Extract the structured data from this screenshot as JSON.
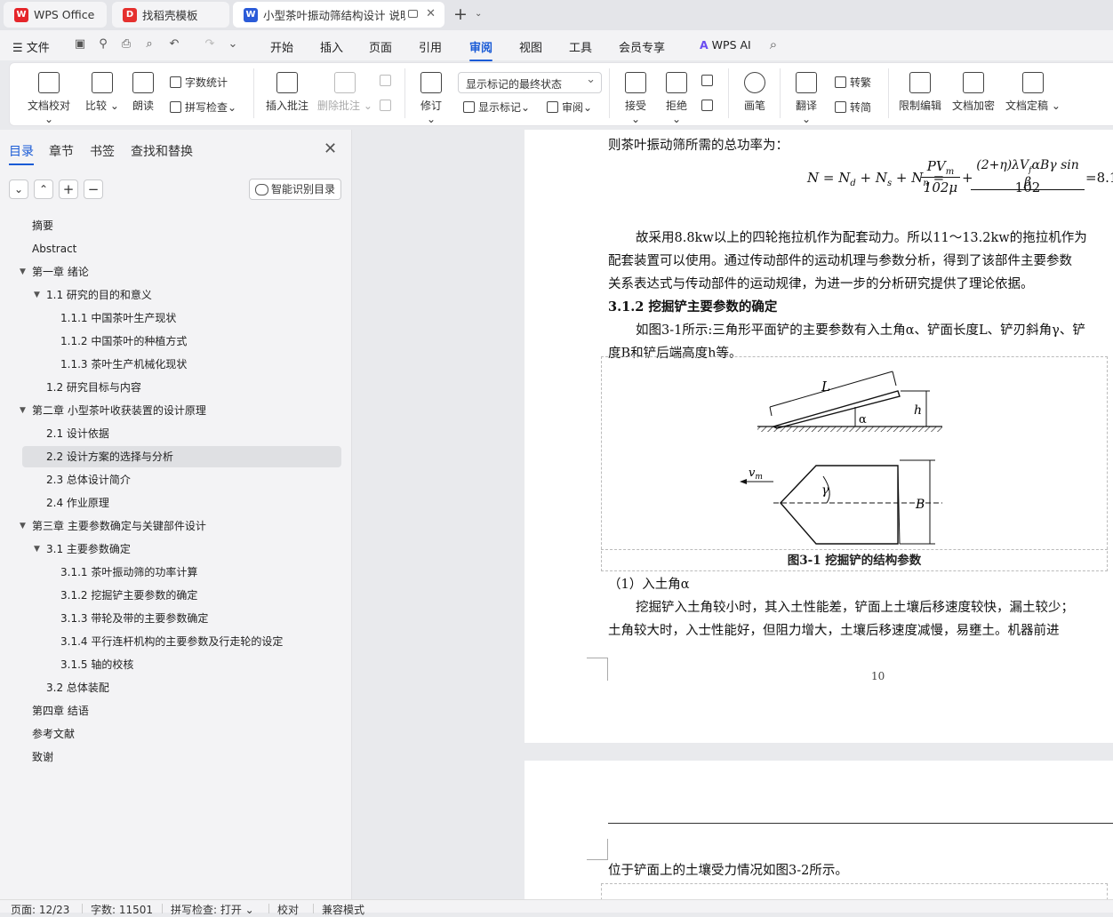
{
  "tabs": [
    {
      "label": "WPS Office",
      "logo_color": "#e5252a",
      "logo": "W"
    },
    {
      "label": "找稻壳模板",
      "logo_color": "#e5302e",
      "logo": "D"
    },
    {
      "label": "小型茶叶振动筛结构设计 说明",
      "logo_color": "#2b5bd8",
      "logo": "W"
    }
  ],
  "menu": {
    "file": "文件",
    "items": [
      "开始",
      "插入",
      "页面",
      "引用",
      "审阅",
      "视图",
      "工具",
      "会员专享"
    ],
    "active": "审阅",
    "wps_ai": "WPS AI"
  },
  "ribbon": {
    "doc_check": "文档校对",
    "compare": "比较",
    "read": "朗读",
    "word_count": "字数统计",
    "spell_check": "拼写检查",
    "insert_comment": "插入批注",
    "delete_comment": "删除批注",
    "revise": "修订",
    "markup_combo": "显示标记的最终状态",
    "show_markup": "显示标记",
    "review": "审阅",
    "accept": "接受",
    "reject": "拒绝",
    "pen": "画笔",
    "translate": "翻译",
    "to_trad": "转繁",
    "to_simp": "转简",
    "restrict_edit": "限制编辑",
    "encrypt": "文档加密",
    "finalize": "文档定稿"
  },
  "pane": {
    "tabs": [
      "目录",
      "章节",
      "书签",
      "查找和替换"
    ],
    "smart_button": "智能识别目录",
    "toc": [
      {
        "t": "摘要",
        "lvl": 0
      },
      {
        "t": "Abstract",
        "lvl": 0
      },
      {
        "t": "第一章  绪论",
        "lvl": 0,
        "exp": true
      },
      {
        "t": "1.1   研究的目的和意义",
        "lvl": 1,
        "exp": true
      },
      {
        "t": "1.1.1   中国茶叶生产现状",
        "lvl": 2
      },
      {
        "t": "1.1.2   中国茶叶的种植方式",
        "lvl": 2
      },
      {
        "t": "1.1.3   茶叶生产机械化现状",
        "lvl": 2
      },
      {
        "t": "1.2   研究目标与内容",
        "lvl": 1
      },
      {
        "t": "第二章  小型茶叶收获装置的设计原理",
        "lvl": 0,
        "exp": true
      },
      {
        "t": "2.1   设计依据",
        "lvl": 1
      },
      {
        "t": "2.2   设计方案的选择与分析",
        "lvl": 1,
        "sel": true
      },
      {
        "t": "2.3   总体设计简介",
        "lvl": 1
      },
      {
        "t": "2.4   作业原理",
        "lvl": 1
      },
      {
        "t": "第三章  主要参数确定与关键部件设计",
        "lvl": 0,
        "exp": true
      },
      {
        "t": "3.1  主要参数确定",
        "lvl": 1,
        "exp": true
      },
      {
        "t": "3.1.1  茶叶振动筛的功率计算",
        "lvl": 2
      },
      {
        "t": "3.1.2  挖掘铲主要参数的确定",
        "lvl": 2
      },
      {
        "t": "3.1.3  带轮及带的主要参数确定",
        "lvl": 2
      },
      {
        "t": "3.1.4 平行连杆机构的主要参数及行走轮的设定",
        "lvl": 2
      },
      {
        "t": "3.1.5  轴的校核",
        "lvl": 2
      },
      {
        "t": "3.2  总体装配",
        "lvl": 1
      },
      {
        "t": "第四章    结语",
        "lvl": 0
      },
      {
        "t": "参考文献",
        "lvl": 0
      },
      {
        "t": "致谢",
        "lvl": 0
      }
    ]
  },
  "doc": {
    "l1": "则茶叶振动筛所需的总功率为：",
    "formula": {
      "lhs": "N = N",
      "d": "d",
      "s": "s",
      "n": "n",
      "num1": "PV",
      "m": "m",
      "den1": "102μ",
      "num2": "(2+η)λV",
      "f": "f",
      "num2b": "αBγ sin β",
      "den2": "102",
      "res": "=8.1"
    },
    "p2a": "故采用8.8kw以上的四轮拖拉机作为配套动力。所以11～13.2kw的拖拉机作为",
    "p2b": "配套装置可以使用。通过传动部件的运动机理与参数分析，得到了该部件主要参数",
    "p2c": "关系表达式与传动部件的运动规律，为进一步的分析研究提供了理论依据。",
    "h312": "3.1.2  挖掘铲主要参数的确定",
    "p3a": "如图3-1所示:三角形平面铲的主要参数有入土角α、铲面长度L、铲刃斜角γ、铲",
    "p3b": "度B和铲后端高度h等。",
    "fig": {
      "L": "L",
      "h": "h",
      "alpha": "α",
      "vm": "v",
      "vm_sub": "m",
      "gamma": "γ",
      "B": "B"
    },
    "caption": "图3-1  挖掘铲的结构参数",
    "item1": "（1）入土角α",
    "p4a": "挖掘铲入土角较小时，其入土性能差，铲面上土壤后移速度较快，漏土较少；",
    "p4b": "土角较大时，入士性能好，但阻力增大，土壤后移速度减慢，易壅土。机器前进",
    "page_no": "10",
    "p5": "位于铲面上的土壤受力情况如图3-2所示。"
  },
  "status": {
    "page": "页面: 12/23",
    "words": "字数: 11501",
    "spell": "拼写检查: 打开",
    "proof": "校对",
    "compat": "兼容模式"
  }
}
